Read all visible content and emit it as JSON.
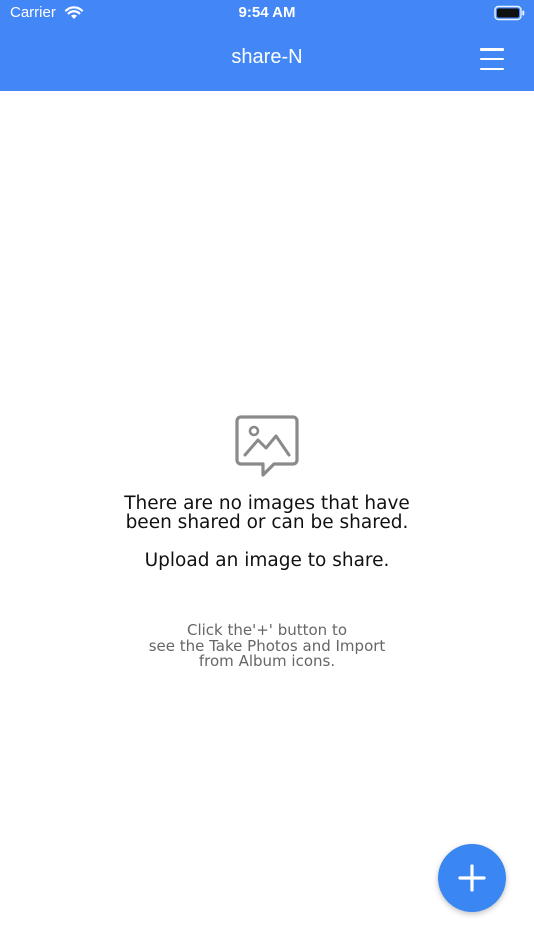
{
  "status_bar": {
    "carrier": "Carrier",
    "time": "9:54 AM"
  },
  "nav": {
    "title": "share-N",
    "menu_icon": "hamburger-menu-icon"
  },
  "empty_state": {
    "icon": "image-message-icon",
    "title": "There are no images that have been shared or can be shared.",
    "subtitle": "Upload an image to share.",
    "hint_lines": [
      "Click the'+' button to",
      "see the Take Photos and Import",
      "from Album icons."
    ]
  },
  "fab": {
    "icon": "plus-icon"
  },
  "colors": {
    "header_bg": "#4287f5",
    "fab_bg": "#3a86f2",
    "icon_gray": "#8a8a8a",
    "hint_text": "#666666"
  }
}
